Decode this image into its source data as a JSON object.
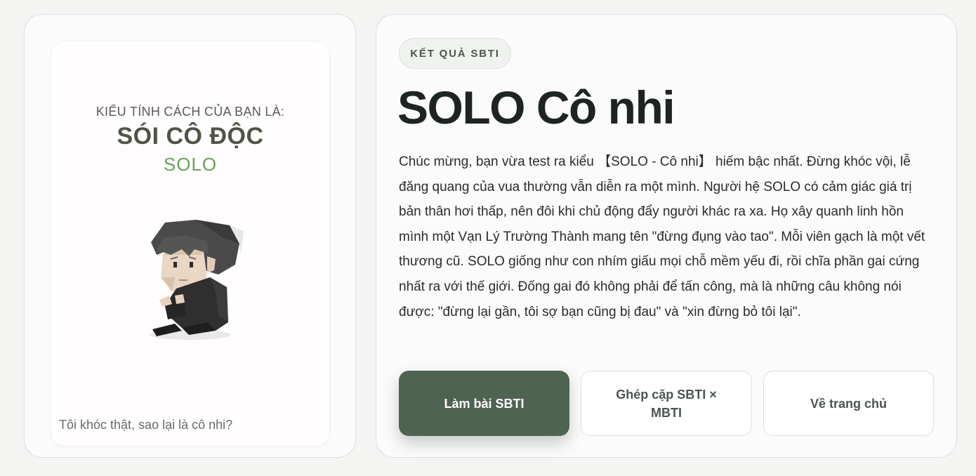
{
  "poster": {
    "kicker": "KIỂU TÍNH CÁCH CỦA BẠN LÀ:",
    "type_name": "SÓI CÔ ĐỘC",
    "type_code": "SOLO",
    "caption": "Tôi khóc thật, sao lại là cô nhi?",
    "illustration_icon": "sad-sitting-figure-icon"
  },
  "result": {
    "badge": "KẾT QUẢ SBTI",
    "title": "SOLO Cô nhi",
    "description": "Chúc mừng, bạn vừa test ra kiểu 【SOLO - Cô nhi】 hiếm bậc nhất. Đừng khóc vội, lễ đăng quang của vua thường vẫn diễn ra một mình. Người hệ SOLO có cảm giác giá trị bản thân hơi thấp, nên đôi khi chủ động đẩy người khác ra xa. Họ xây quanh linh hồn mình một Vạn Lý Trường Thành mang tên \"đừng đụng vào tao\". Mỗi viên gạch là một vết thương cũ. SOLO giống như con nhím giấu mọi chỗ mềm yếu đi, rồi chĩa phần gai cứng nhất ra với thế giới. Đống gai đó không phải để tấn công, mà là những câu không nói được: \"đừng lại gần, tôi sợ bạn cũng bị đau\" và \"xin đừng bỏ tôi lại\"."
  },
  "actions": {
    "take_test": "Làm bài SBTI",
    "pair": "Ghép cặp SBTI × MBTI",
    "home": "Về trang chủ"
  },
  "colors": {
    "primary": "#4f6353",
    "accent_green": "#6aa05c",
    "title_dark": "#1e2420",
    "type_name": "#4f5445"
  }
}
